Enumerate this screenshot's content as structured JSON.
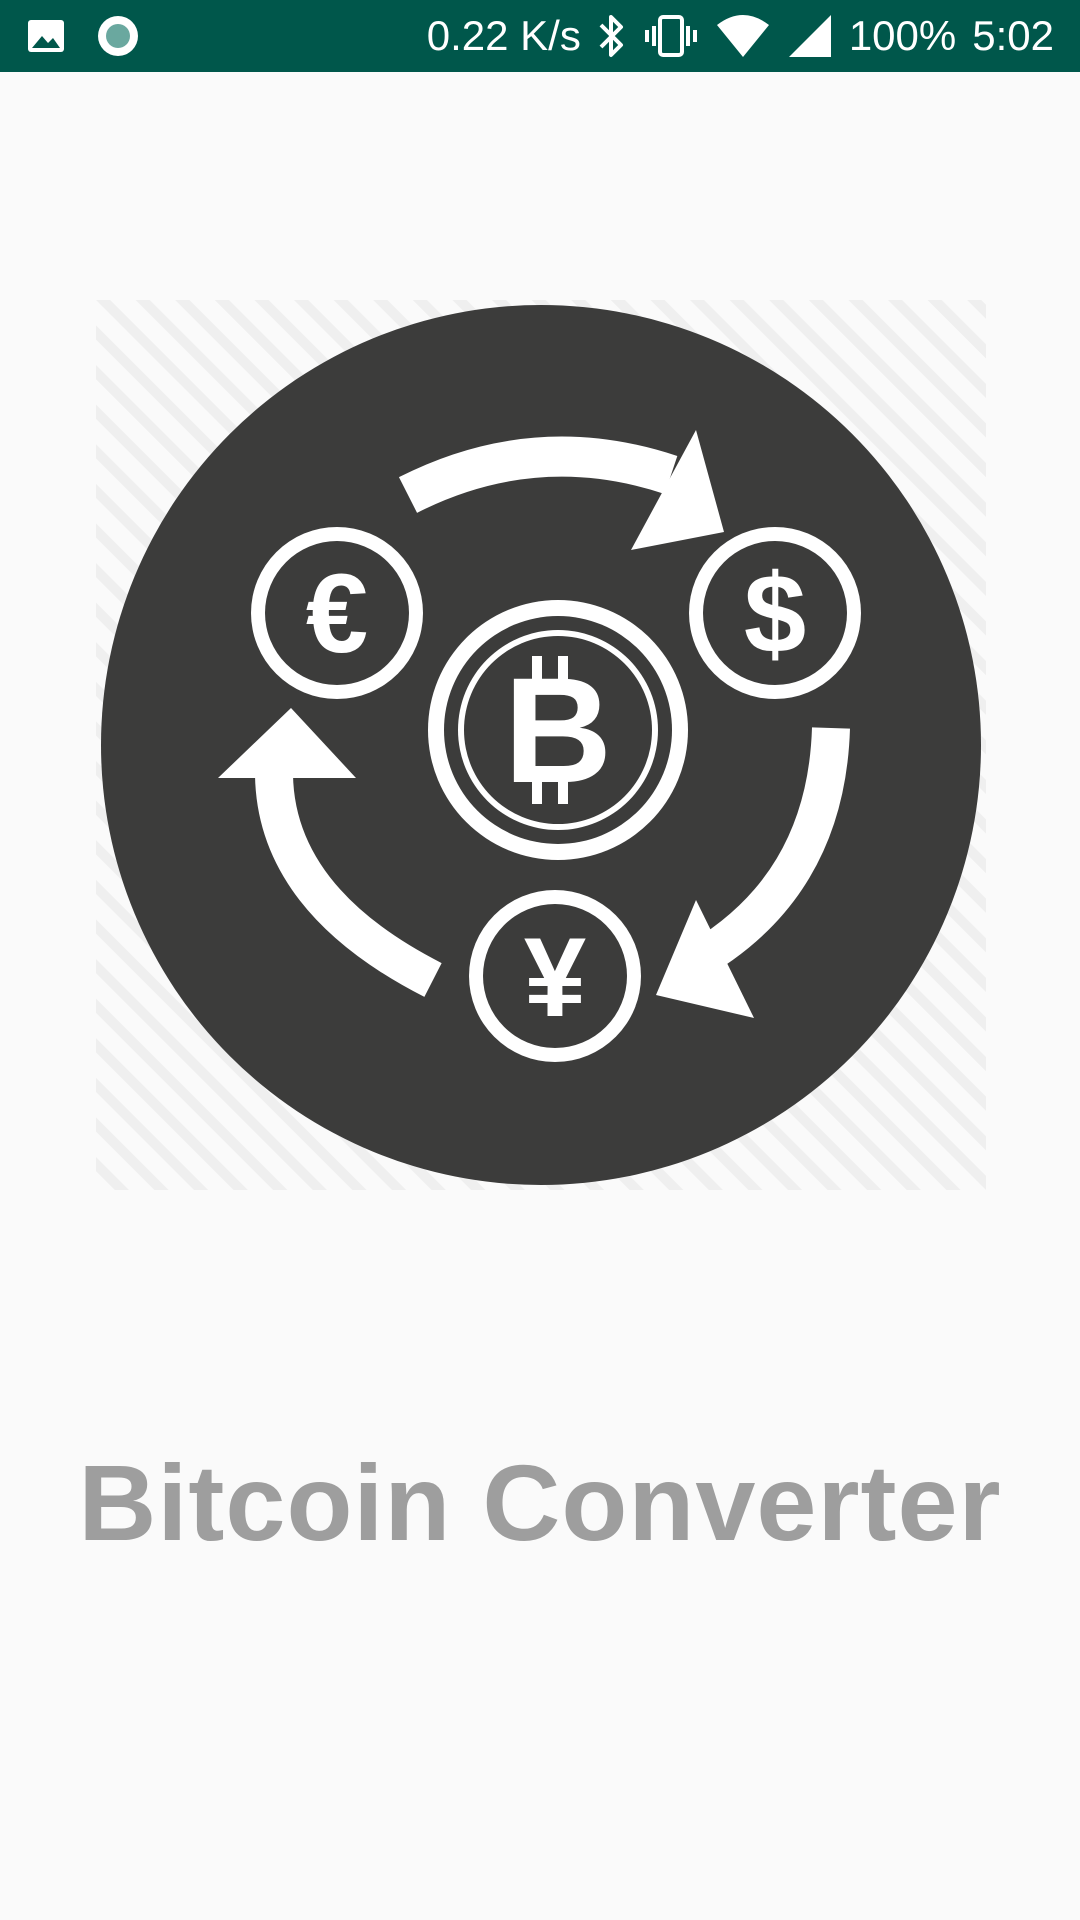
{
  "status_bar": {
    "left_icons": [
      "image-icon",
      "record-icon"
    ],
    "net_speed": "0.22 K/s",
    "battery": "100%",
    "time": "5:02",
    "right_icons": [
      "bluetooth-icon",
      "vibrate-icon",
      "wifi-icon",
      "signal-icon"
    ]
  },
  "logo": {
    "icon": "currency-exchange-icon",
    "symbols": {
      "euro": "€",
      "dollar": "$",
      "bitcoin": "B",
      "yen": "¥"
    },
    "circle_color": "#3c3c3b",
    "mark_color": "#ffffff"
  },
  "app": {
    "title": "Bitcoin Converter",
    "title_color": "#9e9e9e"
  },
  "colors": {
    "status_bar": "#00574b",
    "background": "#fafafa"
  }
}
